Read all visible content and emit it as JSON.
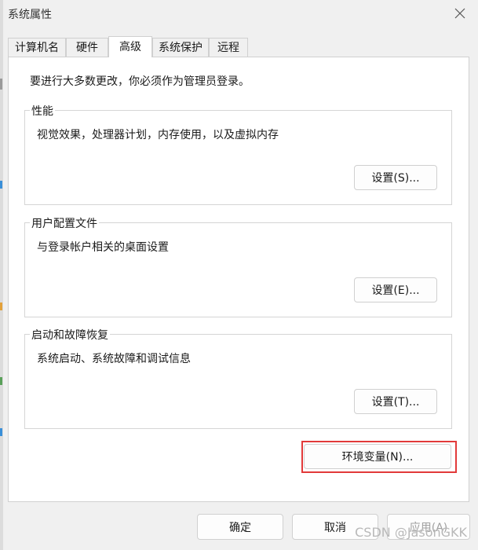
{
  "window": {
    "title": "系统属性"
  },
  "tabs": [
    {
      "label": "计算机名"
    },
    {
      "label": "硬件"
    },
    {
      "label": "高级",
      "active": true
    },
    {
      "label": "系统保护"
    },
    {
      "label": "远程"
    }
  ],
  "advanced": {
    "notice": "要进行大多数更改，你必须作为管理员登录。",
    "groups": [
      {
        "label": "性能",
        "description": "视觉效果，处理器计划，内存使用，以及虚拟内存",
        "button": "设置(S)..."
      },
      {
        "label": "用户配置文件",
        "description": "与登录帐户相关的桌面设置",
        "button": "设置(E)..."
      },
      {
        "label": "启动和故障恢复",
        "description": "系统启动、系统故障和调试信息",
        "button": "设置(T)..."
      }
    ],
    "env_button": "环境变量(N)..."
  },
  "footer": {
    "ok": "确定",
    "cancel": "取消",
    "apply": "应用(A)"
  },
  "watermark": "CSDN @JasonGKK",
  "colors": {
    "highlight": "#e23a3a",
    "window_bg": "#f0f0f0",
    "panel_bg": "#ffffff"
  },
  "icons": {
    "close": "close-icon"
  }
}
